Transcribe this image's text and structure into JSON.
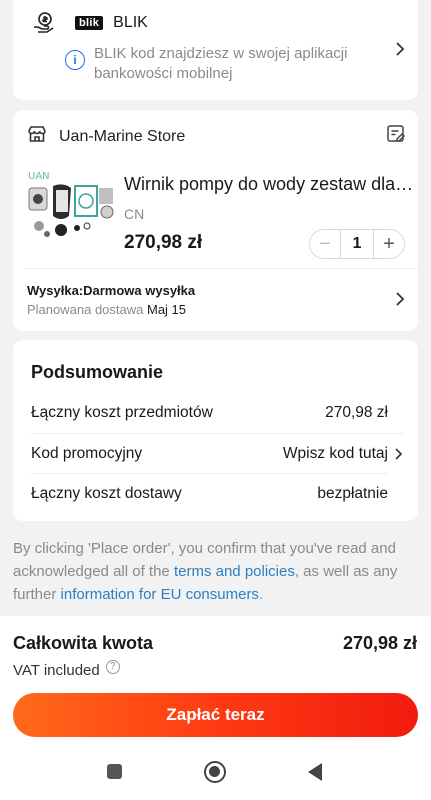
{
  "payment": {
    "method_logo": "blik",
    "method_name": "BLIK",
    "info_text": "BLIK kod znajdziesz w swojej aplikacji bankowości mobilnej",
    "icons": [
      "coin-hand-icon",
      "info-icon",
      "chevron-right-icon"
    ]
  },
  "store": {
    "name": "Uan-Marine Store",
    "icons": [
      "store-icon",
      "note-edit-icon"
    ],
    "product": {
      "title": "Wirnik pompy do wody zestaw dla Yamaha",
      "origin": "CN",
      "price": "270,98 zł",
      "quantity": "1",
      "minus_label": "−",
      "plus_label": "+"
    },
    "shipping_label": "Wysyłka:Darmowa wysyłka",
    "delivery_prefix": "Planowana dostawa",
    "delivery_date": "Maj 15"
  },
  "summary": {
    "title": "Podsumowanie",
    "rows": [
      {
        "label": "Łączny koszt przedmiotów",
        "value": "270,98 zł"
      },
      {
        "label": "Kod promocyjny",
        "value": "Wpisz kod tutaj"
      },
      {
        "label": "Łączny koszt dostawy",
        "value": "bezpłatnie"
      }
    ]
  },
  "disclaimer": {
    "part1": "By clicking 'Place order', you confirm that you've read and acknowledged all of the ",
    "link1": "terms and policies",
    "part2": ", as well as any further ",
    "link2": "information for EU consumers",
    "part3": "."
  },
  "footer": {
    "total_label": "Całkowita kwota",
    "total_value": "270,98 zł",
    "vat_label": "VAT included",
    "pay_button": "Zapłać teraz"
  },
  "colors": {
    "accent_gradient_start": "#ff6a1a",
    "accent_gradient_end": "#f11b0f",
    "link": "#2d7fc1",
    "info_blue": "#1a73e8"
  }
}
